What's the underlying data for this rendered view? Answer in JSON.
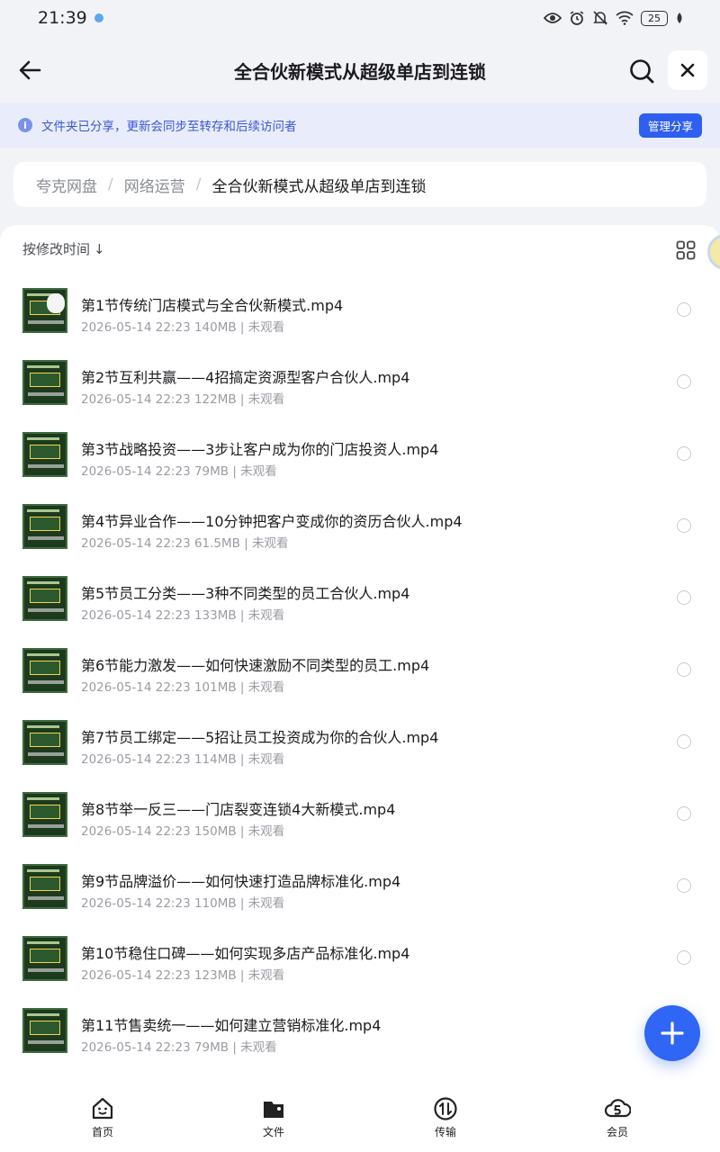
{
  "status_bar": {
    "time": "21:39",
    "battery": "25"
  },
  "header": {
    "title": "全合伙新模式从超级单店到连锁"
  },
  "share_banner": {
    "text": "文件夹已分享，更新会同步至转存和后续访问者",
    "manage_label": "管理分享"
  },
  "breadcrumb": {
    "items": [
      "夸克网盘",
      "网络运营"
    ],
    "current": "全合伙新模式从超级单店到连锁"
  },
  "sort": {
    "label": "按修改时间",
    "arrow": "↓"
  },
  "files": [
    {
      "name": "第1节传统门店模式与全合伙新模式.mp4",
      "meta": "2026-05-14 22:23  140MB | 未观看"
    },
    {
      "name": "第2节互利共赢——4招搞定资源型客户合伙人.mp4",
      "meta": "2026-05-14 22:23  122MB | 未观看"
    },
    {
      "name": "第3节战略投资——3步让客户成为你的门店投资人.mp4",
      "meta": "2026-05-14 22:23  79MB | 未观看"
    },
    {
      "name": "第4节异业合作——10分钟把客户变成你的资历合伙人.mp4",
      "meta": "2026-05-14 22:23  61.5MB | 未观看"
    },
    {
      "name": "第5节员工分类——3种不同类型的员工合伙人.mp4",
      "meta": "2026-05-14 22:23  133MB | 未观看"
    },
    {
      "name": "第6节能力激发——如何快速激励不同类型的员工.mp4",
      "meta": "2026-05-14 22:23  101MB | 未观看"
    },
    {
      "name": "第7节员工绑定——5招让员工投资成为你的合伙人.mp4",
      "meta": "2026-05-14 22:23  114MB | 未观看"
    },
    {
      "name": "第8节举一反三——门店裂变连锁4大新模式.mp4",
      "meta": "2026-05-14 22:23  150MB | 未观看"
    },
    {
      "name": "第9节品牌溢价——如何快速打造品牌标准化.mp4",
      "meta": "2026-05-14 22:23  110MB | 未观看"
    },
    {
      "name": "第10节稳住口碑——如何实现多店产品标准化.mp4",
      "meta": "2026-05-14 22:23  123MB | 未观看"
    },
    {
      "name": "第11节售卖统一——如何建立营销标准化.mp4",
      "meta": "2026-05-14 22:23  79MB | 未观看"
    }
  ],
  "bottom_nav": [
    {
      "label": "首页",
      "icon": "home-face-icon"
    },
    {
      "label": "文件",
      "icon": "folder-icon"
    },
    {
      "label": "传输",
      "icon": "transfer-icon"
    },
    {
      "label": "会员",
      "icon": "vip-cloud-icon"
    }
  ],
  "colors": {
    "accent": "#2e5ff0",
    "banner_bg": "#e9edfb",
    "page_bg": "#f2f3f6"
  }
}
